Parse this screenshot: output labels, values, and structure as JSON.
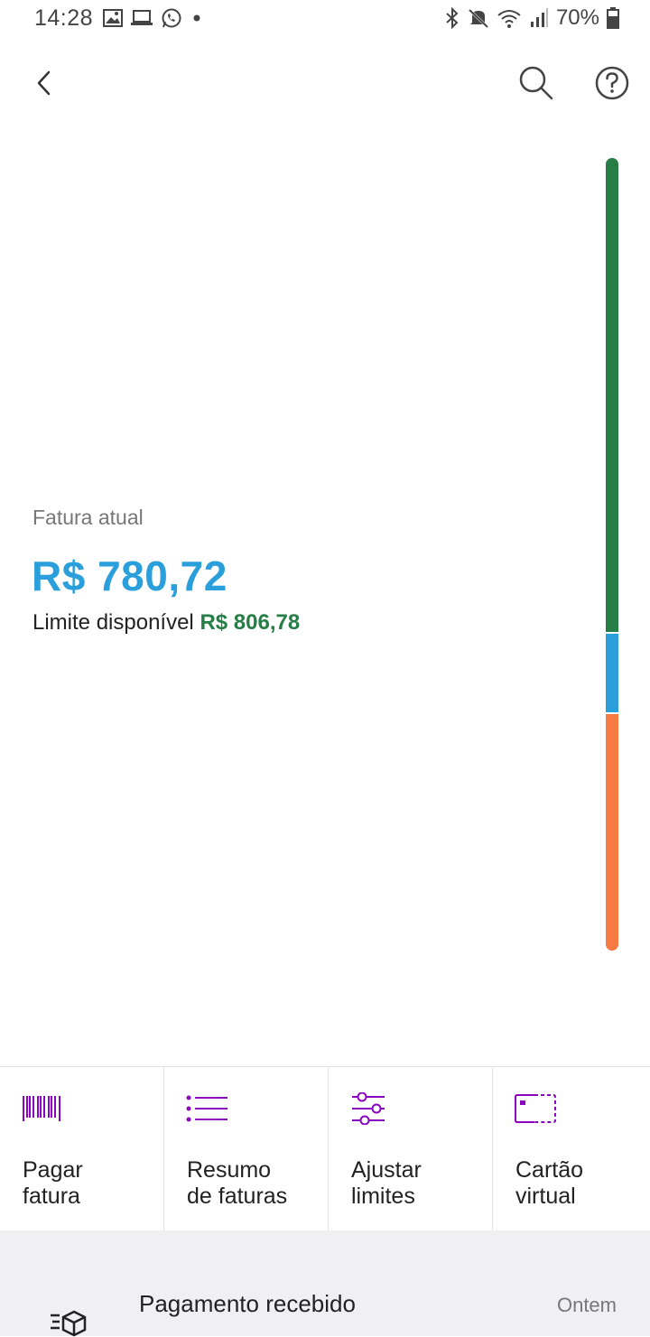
{
  "status_bar": {
    "time": "14:28",
    "battery_percent": "70%"
  },
  "header": {
    "back_icon": "chevron-left-icon",
    "search_icon": "search-icon",
    "help_icon": "help-icon"
  },
  "credit": {
    "invoice_label": "Fatura atual",
    "invoice_amount": "R$ 780,72",
    "limit_label": "Limite disponível",
    "limit_amount": "R$ 806,78",
    "limit_bar_colors": {
      "available": "#267d45",
      "current_invoice": "#2b9fdb",
      "future_invoices": "#f57b42"
    }
  },
  "shortcuts": [
    {
      "label": "Pagar\nfatura",
      "icon": "barcode-icon"
    },
    {
      "label": "Resumo\nde faturas",
      "icon": "list-icon"
    },
    {
      "label": "Ajustar\nlimites",
      "icon": "sliders-icon"
    },
    {
      "label": "Cartão\nvirtual",
      "icon": "virtual-card-icon"
    }
  ],
  "feed": {
    "title": "Pagamento recebido",
    "date": "Ontem",
    "icon": "payment-received-icon"
  },
  "colors": {
    "accent_purple": "#8a05be",
    "amount_blue": "#2b9fdb",
    "limit_green": "#267d45"
  }
}
